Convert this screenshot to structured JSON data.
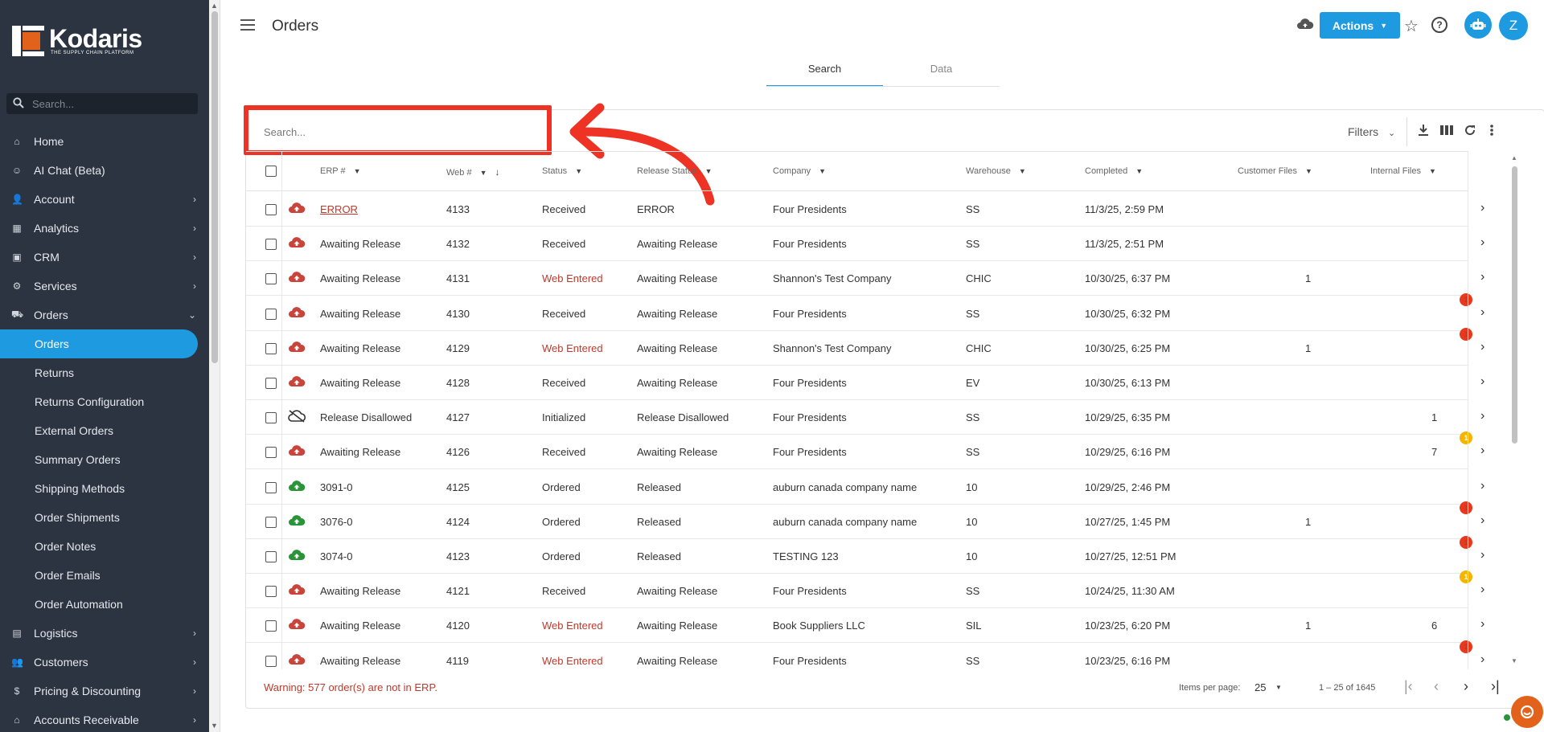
{
  "brand": {
    "name": "Kodaris",
    "tagline": "THE SUPPLY CHAIN PLATFORM"
  },
  "sidebar": {
    "search_placeholder": "Search...",
    "items": [
      {
        "label": "Home",
        "icon": "home-icon",
        "chevron": false
      },
      {
        "label": "AI Chat (Beta)",
        "icon": "robot-icon",
        "chevron": false
      },
      {
        "label": "Account",
        "icon": "person-icon",
        "chevron": true
      },
      {
        "label": "Analytics",
        "icon": "chart-icon",
        "chevron": true
      },
      {
        "label": "CRM",
        "icon": "contacts-icon",
        "chevron": true
      },
      {
        "label": "Services",
        "icon": "gears-icon",
        "chevron": true
      },
      {
        "label": "Orders",
        "icon": "truck-icon",
        "chevron": "down"
      }
    ],
    "orders_sub": [
      "Orders",
      "Returns",
      "Returns Configuration",
      "External Orders",
      "Summary Orders",
      "Shipping Methods",
      "Order Shipments",
      "Order Notes",
      "Order Emails",
      "Order Automation"
    ],
    "items_after": [
      {
        "label": "Logistics",
        "icon": "boxes-icon"
      },
      {
        "label": "Customers",
        "icon": "people-icon"
      },
      {
        "label": "Pricing & Discounting",
        "icon": "dollar-icon"
      },
      {
        "label": "Accounts Receivable",
        "icon": "bank-icon"
      }
    ]
  },
  "header": {
    "title": "Orders",
    "actions_label": "Actions",
    "avatar_letter": "Z"
  },
  "tabs": [
    {
      "label": "Search",
      "active": true
    },
    {
      "label": "Data",
      "active": false
    }
  ],
  "toolbar": {
    "search_placeholder": "Search...",
    "filters_label": "Filters"
  },
  "table": {
    "columns": [
      "ERP #",
      "Web #",
      "Status",
      "Release Status",
      "Company",
      "Warehouse",
      "Completed",
      "Customer Files",
      "Internal Files"
    ],
    "rows": [
      {
        "icon": "cloud-upload-red",
        "erp": "ERROR",
        "erp_link": true,
        "web": "4133",
        "status": "Received",
        "status_red": false,
        "release": "ERROR",
        "company": "Four Presidents",
        "warehouse": "SS",
        "completed": "11/3/25, 2:59 PM",
        "cust_files": "",
        "int_files": "",
        "badge": null
      },
      {
        "icon": "cloud-upload-red",
        "erp": "Awaiting Release",
        "web": "4132",
        "status": "Received",
        "status_red": false,
        "release": "Awaiting Release",
        "company": "Four Presidents",
        "warehouse": "SS",
        "completed": "11/3/25, 2:51 PM",
        "cust_files": "",
        "int_files": "",
        "badge": null
      },
      {
        "icon": "cloud-upload-red",
        "erp": "Awaiting Release",
        "web": "4131",
        "status": "Web Entered",
        "status_red": true,
        "release": "Awaiting Release",
        "company": "Shannon's Test Company",
        "warehouse": "CHIC",
        "completed": "10/30/25, 6:37 PM",
        "cust_files": "1",
        "int_files": "",
        "badge": null
      },
      {
        "icon": "cloud-upload-red",
        "erp": "Awaiting Release",
        "web": "4130",
        "status": "Received",
        "status_red": false,
        "release": "Awaiting Release",
        "company": "Four Presidents",
        "warehouse": "SS",
        "completed": "10/30/25, 6:32 PM",
        "cust_files": "",
        "int_files": "",
        "badge": {
          "count": "1",
          "color": "red"
        }
      },
      {
        "icon": "cloud-upload-red",
        "erp": "Awaiting Release",
        "web": "4129",
        "status": "Web Entered",
        "status_red": true,
        "release": "Awaiting Release",
        "company": "Shannon's Test Company",
        "warehouse": "CHIC",
        "completed": "10/30/25, 6:25 PM",
        "cust_files": "1",
        "int_files": "",
        "badge": {
          "count": "1",
          "color": "red"
        }
      },
      {
        "icon": "cloud-upload-red",
        "erp": "Awaiting Release",
        "web": "4128",
        "status": "Received",
        "status_red": false,
        "release": "Awaiting Release",
        "company": "Four Presidents",
        "warehouse": "EV",
        "completed": "10/30/25, 6:13 PM",
        "cust_files": "",
        "int_files": "",
        "badge": null
      },
      {
        "icon": "cloud-off",
        "erp": "Release Disallowed",
        "web": "4127",
        "status": "Initialized",
        "status_red": false,
        "release": "Release Disallowed",
        "company": "Four Presidents",
        "warehouse": "SS",
        "completed": "10/29/25, 6:35 PM",
        "cust_files": "",
        "int_files": "1",
        "badge": null
      },
      {
        "icon": "cloud-upload-red",
        "erp": "Awaiting Release",
        "web": "4126",
        "status": "Received",
        "status_red": false,
        "release": "Awaiting Release",
        "company": "Four Presidents",
        "warehouse": "SS",
        "completed": "10/29/25, 6:16 PM",
        "cust_files": "",
        "int_files": "7",
        "badge": {
          "count": "1",
          "color": "amber"
        }
      },
      {
        "icon": "cloud-upload-green",
        "erp": "3091-0",
        "web": "4125",
        "status": "Ordered",
        "status_red": false,
        "release": "Released",
        "company": "auburn canada company name",
        "warehouse": "10",
        "completed": "10/29/25, 2:46 PM",
        "cust_files": "",
        "int_files": "",
        "badge": null
      },
      {
        "icon": "cloud-upload-green",
        "erp": "3076-0",
        "web": "4124",
        "status": "Ordered",
        "status_red": false,
        "release": "Released",
        "company": "auburn canada company name",
        "warehouse": "10",
        "completed": "10/27/25, 1:45 PM",
        "cust_files": "1",
        "int_files": "",
        "badge": {
          "count": "1",
          "color": "red"
        }
      },
      {
        "icon": "cloud-upload-green",
        "erp": "3074-0",
        "web": "4123",
        "status": "Ordered",
        "status_red": false,
        "release": "Released",
        "company": "TESTING 123",
        "warehouse": "10",
        "completed": "10/27/25, 12:51 PM",
        "cust_files": "",
        "int_files": "",
        "badge": {
          "count": "1",
          "color": "red"
        }
      },
      {
        "icon": "cloud-upload-red",
        "erp": "Awaiting Release",
        "web": "4121",
        "status": "Received",
        "status_red": false,
        "release": "Awaiting Release",
        "company": "Four Presidents",
        "warehouse": "SS",
        "completed": "10/24/25, 11:30 AM",
        "cust_files": "",
        "int_files": "",
        "badge": {
          "count": "1",
          "color": "amber"
        }
      },
      {
        "icon": "cloud-upload-red",
        "erp": "Awaiting Release",
        "web": "4120",
        "status": "Web Entered",
        "status_red": true,
        "release": "Awaiting Release",
        "company": "Book Suppliers LLC",
        "warehouse": "SIL",
        "completed": "10/23/25, 6:20 PM",
        "cust_files": "1",
        "int_files": "6",
        "badge": null
      },
      {
        "icon": "cloud-upload-red",
        "erp": "Awaiting Release",
        "web": "4119",
        "status": "Web Entered",
        "status_red": true,
        "release": "Awaiting Release",
        "company": "Four Presidents",
        "warehouse": "SS",
        "completed": "10/23/25, 6:16 PM",
        "cust_files": "",
        "int_files": "",
        "badge": {
          "count": "1",
          "color": "red"
        }
      }
    ]
  },
  "footer": {
    "warning": "Warning: 577 order(s) are not in ERP.",
    "items_per_page_label": "Items per page:",
    "items_per_page": "25",
    "range": "1 – 25 of 1645"
  },
  "colors": {
    "accent": "#1e9be0",
    "sidebar_bg": "#2b3440",
    "error_red": "#c0392b",
    "highlight_red": "#ee3224",
    "success_green": "#2a9438"
  }
}
